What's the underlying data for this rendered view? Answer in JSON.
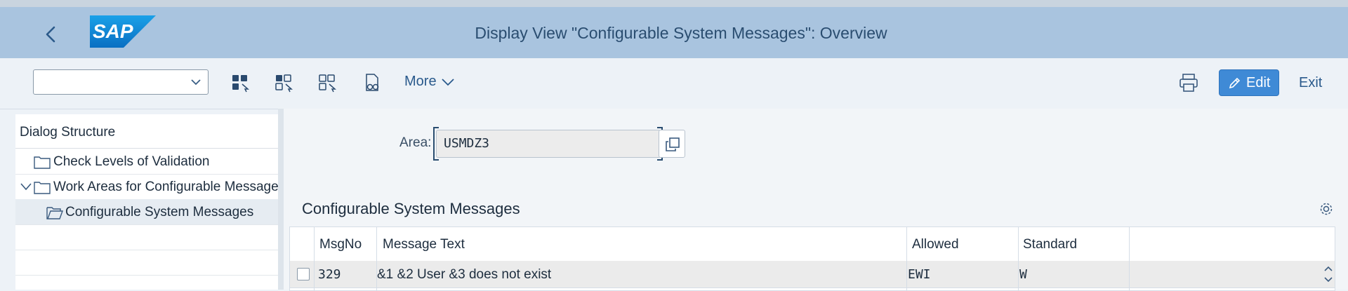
{
  "shell": {
    "title": "Display View \"Configurable System Messages\": Overview",
    "logo_text": "SAP"
  },
  "toolbar": {
    "combo_value": "",
    "more_label": "More",
    "edit_label": "Edit",
    "exit_label": "Exit"
  },
  "dialog": {
    "header": "Dialog Structure",
    "items": [
      {
        "label": "Check Levels of Validation"
      },
      {
        "label": "Work Areas for Configurable Messages"
      },
      {
        "label": "Configurable System Messages"
      }
    ]
  },
  "area": {
    "label": "Area:",
    "value": "USMDZ3"
  },
  "table": {
    "title": "Configurable System Messages",
    "columns": [
      "MsgNo",
      "Message Text",
      "Allowed",
      "Standard"
    ],
    "rows": [
      {
        "msgno": "329",
        "text": "&1 &2 User &3 does not exist",
        "allowed": "EWI",
        "standard": "W"
      }
    ]
  },
  "colors": {
    "shellbar": "#a9c4df",
    "accent": "#3f8ad6",
    "background": "#edf2f7"
  }
}
